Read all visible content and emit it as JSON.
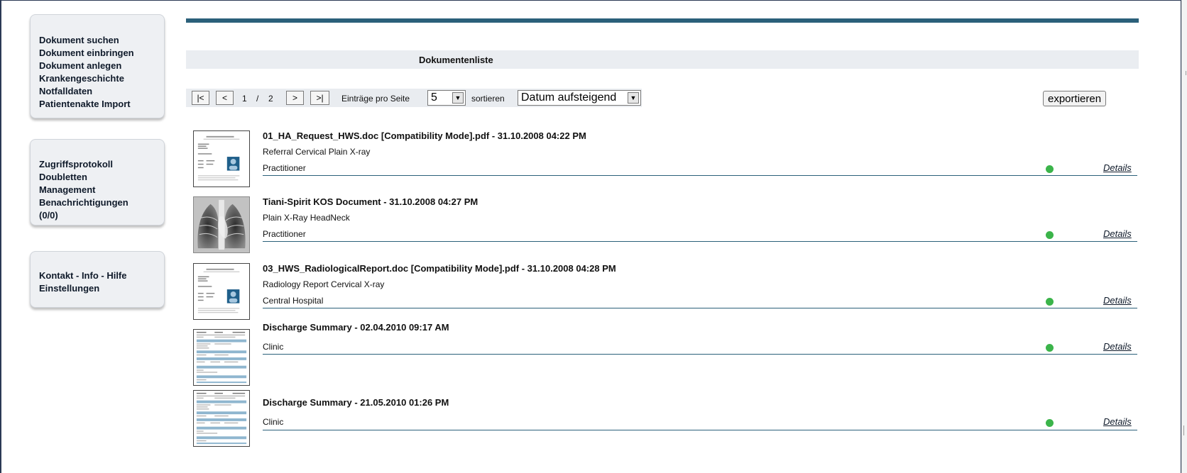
{
  "nav": {
    "group1": [
      "Dokument suchen",
      "Dokument einbringen",
      "Dokument anlegen",
      "Krankengeschichte",
      "Notfalldaten",
      "Patientenakte Import"
    ],
    "group2": [
      "Zugriffsprotokoll",
      "Doubletten",
      "Management",
      "Benachrichtigungen",
      "(0/0)"
    ],
    "group3": [
      "Kontakt - Info - Hilfe",
      "Einstellungen"
    ]
  },
  "header": {
    "title": "Dokumentenliste"
  },
  "pager": {
    "first": "|<",
    "prev": "<",
    "current": "1",
    "separator": "/",
    "total": "2",
    "next": ">",
    "last": ">|",
    "per_page_label": "Einträge pro Seite",
    "per_page_value": "5",
    "sort_label": "sortieren",
    "sort_value": "Datum aufsteigend",
    "export_label": "exportieren"
  },
  "documents": [
    {
      "title": "01_HA_Request_HWS.doc [Compatibility Mode].pdf - 31.10.2008 04:22 PM",
      "type": "Referral Cervical Plain X-ray",
      "author": "Practitioner",
      "details": "Details",
      "thumb": "doc-page-icon"
    },
    {
      "title": "Tiani-Spirit KOS Document - 31.10.2008 04:27 PM",
      "type": "Plain X-Ray HeadNeck",
      "author": "Practitioner",
      "details": "Details",
      "thumb": "xray-icon"
    },
    {
      "title": "03_HWS_RadiologicalReport.doc [Compatibility Mode].pdf - 31.10.2008 04:28 PM",
      "type": "Radiology Report Cervical X-ray",
      "author": "Central Hospital",
      "details": "Details",
      "thumb": "doc-page-icon"
    },
    {
      "title": "Discharge Summary - 02.04.2010 09:17 AM",
      "type": "",
      "author": "Clinic",
      "details": "Details",
      "thumb": "table-doc-icon"
    },
    {
      "title": "Discharge Summary - 21.05.2010 01:26 PM",
      "type": "",
      "author": "Clinic",
      "details": "Details",
      "thumb": "table-doc-icon"
    }
  ],
  "colors": {
    "accent": "#2b607a",
    "status_ok": "#3bb44a",
    "band": "#eaedf1"
  }
}
